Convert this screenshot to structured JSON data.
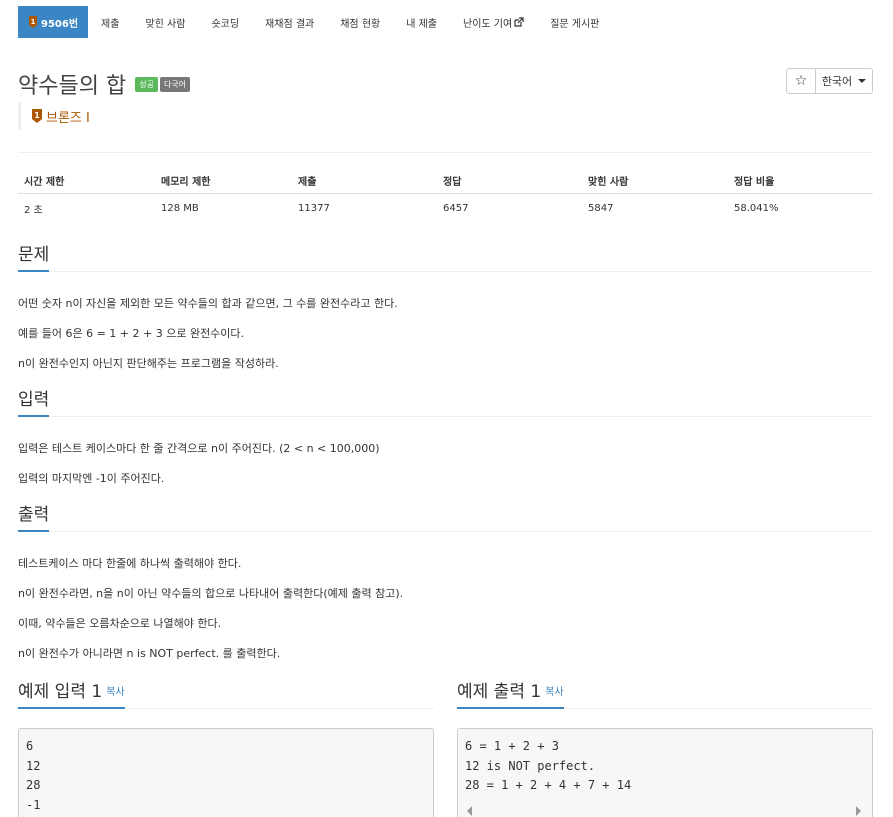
{
  "nav": {
    "problem_number": "9506번",
    "tabs": [
      "제출",
      "맞힌 사람",
      "숏코딩",
      "재채점 결과",
      "채점 현황",
      "내 제출",
      "난이도 기여",
      "질문 게시판"
    ]
  },
  "problem": {
    "title": "약수들의 합",
    "badge_success": "성공",
    "badge_multilang": "다국어",
    "tier": "브론즈 I",
    "tier_color": "#ad5600"
  },
  "controls": {
    "star": "☆",
    "language": "한국어"
  },
  "stats": {
    "headers": [
      "시간 제한",
      "메모리 제한",
      "제출",
      "정답",
      "맞힌 사람",
      "정답 비율"
    ],
    "values": [
      "2 초",
      "128 MB",
      "11377",
      "6457",
      "5847",
      "58.041%"
    ]
  },
  "sections": {
    "problem": {
      "heading": "문제",
      "lines": [
        "어떤 숫자 n이 자신을 제외한 모든 약수들의 합과 같으면, 그 수를 완전수라고 한다.",
        "예를 들어 6은 6 = 1 + 2 + 3 으로 완전수이다.",
        "n이 완전수인지 아닌지 판단해주는 프로그램을 작성하라."
      ]
    },
    "input": {
      "heading": "입력",
      "lines": [
        "입력은 테스트 케이스마다 한 줄 간격으로 n이 주어진다. (2 < n < 100,000)",
        "입력의 마지막엔 -1이 주어진다."
      ]
    },
    "output": {
      "heading": "출력",
      "lines": [
        "테스트케이스 마다 한줄에 하나씩 출력해야 한다.",
        "n이 완전수라면, n을 n이 아닌 약수들의 합으로 나타내어 출력한다(예제 출력 참고).",
        "이때, 약수들은 오름차순으로 나열해야 한다.",
        "n이 완전수가 아니라면 n is NOT perfect. 를 출력한다."
      ]
    }
  },
  "samples": {
    "input_heading": "예제 입력 1",
    "output_heading": "예제 출력 1",
    "copy_label": "복사",
    "input_text": "6\n12\n28\n-1",
    "output_text": "6 = 1 + 2 + 3\n12 is NOT perfect.\n28 = 1 + 2 + 4 + 7 + 14"
  },
  "colors": {
    "accent": "#3a86c4",
    "success": "#5cb85c",
    "multilang": "#777777",
    "bronze": "#ad5600"
  }
}
